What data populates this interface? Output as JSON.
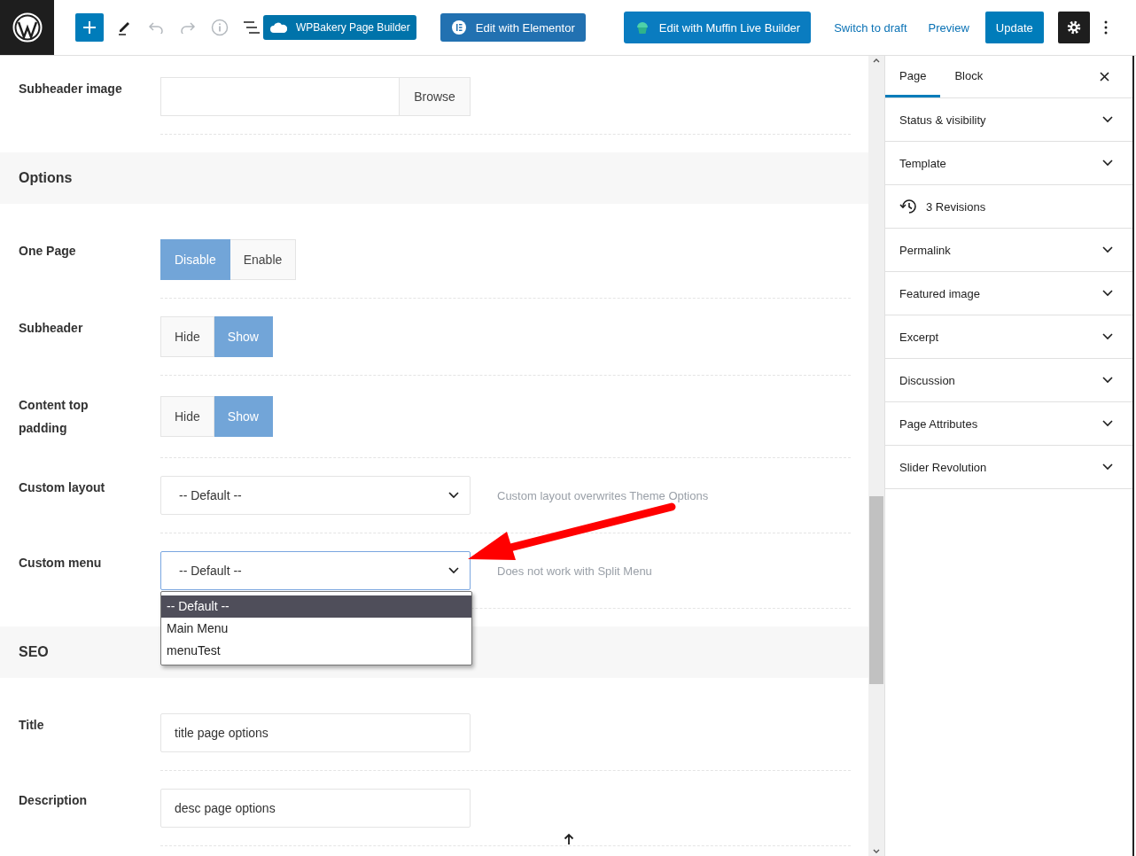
{
  "toolbar": {
    "icons": [
      {
        "kind": "add",
        "disabled": false
      },
      {
        "kind": "edit",
        "disabled": false
      },
      {
        "kind": "undo",
        "disabled": true
      },
      {
        "kind": "redo",
        "disabled": true
      },
      {
        "kind": "info",
        "disabled": true
      },
      {
        "kind": "list",
        "disabled": false
      }
    ],
    "builders": [
      {
        "kind": "wpbakery",
        "label": "WPBakery Page Builder"
      },
      {
        "kind": "elementor",
        "label": "Edit with Elementor"
      },
      {
        "kind": "muffin",
        "label": "Edit with Muffin Live Builder"
      }
    ],
    "links": [
      "Switch to draft",
      "Preview"
    ],
    "primary": "Update"
  },
  "main": {
    "rows": [
      {
        "kind": "file",
        "label": "Subheader image",
        "button": "Browse"
      },
      {
        "kind": "section",
        "label": "Options"
      },
      {
        "kind": "toggle",
        "label": "One Page",
        "options": [
          {
            "label": "Disable",
            "selected": true
          },
          {
            "label": "Enable",
            "selected": false
          }
        ]
      },
      {
        "kind": "toggle",
        "label": "Subheader",
        "options": [
          {
            "label": "Hide",
            "selected": false
          },
          {
            "label": "Show",
            "selected": true
          }
        ]
      },
      {
        "kind": "toggle",
        "label": "Content top padding",
        "options": [
          {
            "label": "Hide",
            "selected": false
          },
          {
            "label": "Show",
            "selected": true
          }
        ]
      },
      {
        "kind": "select",
        "label": "Custom layout",
        "value": "-- Default --",
        "note": "Custom layout overwrites Theme Options",
        "expanded": false
      },
      {
        "kind": "select",
        "label": "Custom menu",
        "value": "-- Default --",
        "note": "Does not work with Split Menu",
        "expanded": true,
        "options": [
          {
            "label": "-- Default --",
            "selected": true
          },
          {
            "label": "Main Menu",
            "selected": false
          },
          {
            "label": "menuTest",
            "selected": false
          }
        ]
      },
      {
        "kind": "section",
        "label": "SEO"
      },
      {
        "kind": "text",
        "label": "Title",
        "value": "title page options"
      },
      {
        "kind": "text",
        "label": "Description",
        "value": "desc page options"
      }
    ]
  },
  "sidebar": {
    "tabs": [
      {
        "label": "Page",
        "selected": true
      },
      {
        "label": "Block",
        "selected": false
      }
    ],
    "panels": [
      {
        "kind": "panel",
        "label": "Status & visibility"
      },
      {
        "kind": "panel",
        "label": "Template"
      },
      {
        "kind": "revisions",
        "label": "3 Revisions"
      },
      {
        "kind": "panel",
        "label": "Permalink"
      },
      {
        "kind": "panel",
        "label": "Featured image"
      },
      {
        "kind": "panel",
        "label": "Excerpt"
      },
      {
        "kind": "panel",
        "label": "Discussion"
      },
      {
        "kind": "panel",
        "label": "Page Attributes"
      },
      {
        "kind": "panel",
        "label": "Slider Revolution"
      }
    ]
  }
}
